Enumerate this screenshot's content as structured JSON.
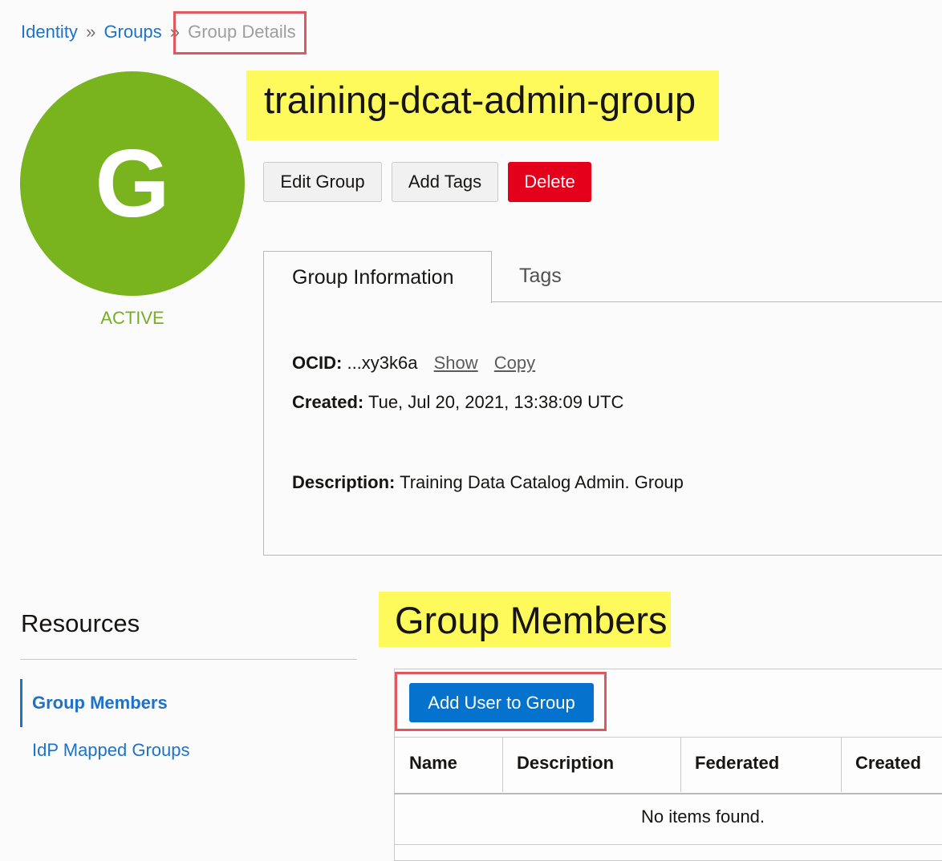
{
  "breadcrumb": {
    "items": [
      "Identity",
      "Groups"
    ],
    "separator": "»",
    "current": "Group Details"
  },
  "group": {
    "avatar_letter": "G",
    "status": "ACTIVE",
    "name": "training-dcat-admin-group"
  },
  "actions": {
    "edit_label": "Edit Group",
    "add_tags_label": "Add Tags",
    "delete_label": "Delete"
  },
  "tabs": [
    {
      "label": "Group Information",
      "active": true
    },
    {
      "label": "Tags",
      "active": false
    }
  ],
  "info": {
    "ocid_label": "OCID:",
    "ocid_value": "...xy3k6a",
    "show_link": "Show",
    "copy_link": "Copy",
    "created_label": "Created:",
    "created_value": "Tue, Jul 20, 2021, 13:38:09 UTC",
    "description_label": "Description:",
    "description_value": "Training Data Catalog Admin. Group"
  },
  "resources": {
    "heading": "Resources",
    "items": [
      {
        "label": "Group Members",
        "active": true
      },
      {
        "label": "IdP Mapped Groups",
        "active": false
      }
    ]
  },
  "members": {
    "heading": "Group Members",
    "add_button": "Add User to Group",
    "columns": [
      "Name",
      "Description",
      "Federated",
      "Created"
    ],
    "empty_message": "No items found."
  },
  "colors": {
    "avatar": "#79b31d",
    "link": "#1e72c8",
    "highlight": "#fffa5c",
    "danger": "#e4001b",
    "primary": "#0572ce",
    "annotation_box": "#e0575f"
  }
}
